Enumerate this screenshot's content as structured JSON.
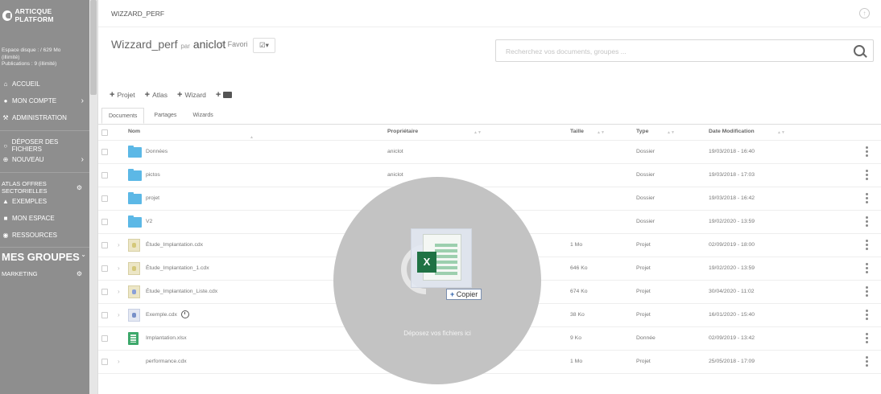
{
  "sidebar": {
    "brand": "ARTICQUE PLATFORM",
    "disk_line1": "Espace disque : / 629 Mo",
    "disk_line2": "(illimité)",
    "disk_line3": "Publications : 9 (illimité)",
    "items": [
      {
        "label": "ACCUEIL",
        "icon": "home-icon"
      },
      {
        "label": "MON COMPTE",
        "icon": "user-icon"
      },
      {
        "label": "ADMINISTRATION",
        "icon": "wrench-icon"
      },
      {
        "label": "DÉPOSER DES FICHIERS",
        "icon": "upload-icon"
      },
      {
        "label": "NOUVEAU",
        "icon": "plus-circle-icon"
      },
      {
        "label": "ATLAS OFFRES SECTORIELLES",
        "icon": "gear-icon"
      },
      {
        "label": "EXEMPLES",
        "icon": "graduation-cap-icon"
      },
      {
        "label": "MON ESPACE",
        "icon": "briefcase-icon"
      },
      {
        "label": "RESSOURCES",
        "icon": "globe-icon"
      }
    ],
    "groups_title": "MES GROUPES",
    "group_item": "MARKETING"
  },
  "topbar": {
    "breadcrumb": "WIZZARD_PERF"
  },
  "header": {
    "title": "Wizzard_perf",
    "par": "par",
    "owner": "aniclot",
    "favori": "Favori",
    "search_placeholder": "Recherchez vos documents, groupes ..."
  },
  "actions": {
    "projet": "Projet",
    "atlas": "Atlas",
    "wizard": "Wizard"
  },
  "tabs": [
    "Documents",
    "Partages",
    "Wizards"
  ],
  "table": {
    "columns": {
      "name": "Nom",
      "owner": "Propriétaire",
      "size": "Taille",
      "type": "Type",
      "date": "Date Modification"
    },
    "rows": [
      {
        "name": "Données",
        "owner": "aniclot",
        "size": "",
        "type": "Dossier",
        "date": "19/03/2018 - 16:40"
      },
      {
        "name": "pictos",
        "owner": "aniclot",
        "size": "",
        "type": "Dossier",
        "date": "19/03/2018 - 17:03"
      },
      {
        "name": "projet",
        "owner": "",
        "size": "",
        "type": "Dossier",
        "date": "19/03/2018 - 16:42"
      },
      {
        "name": "V2",
        "owner": "",
        "size": "",
        "type": "Dossier",
        "date": "19/02/2020 - 13:59"
      },
      {
        "name": "Étude_Implantation.cdx",
        "owner": "",
        "size": "1 Mo",
        "type": "Projet",
        "date": "02/09/2019 - 18:00"
      },
      {
        "name": "Étude_Implantation_1.cdx",
        "owner": "",
        "size": "646 Ko",
        "type": "Projet",
        "date": "19/02/2020 - 13:59"
      },
      {
        "name": "Étude_Implantation_Liste.cdx",
        "owner": "",
        "size": "674 Ko",
        "type": "Projet",
        "date": "30/04/2020 - 11:02"
      },
      {
        "name": "Exemple.cdx",
        "owner": "",
        "size": "38 Ko",
        "type": "Projet",
        "date": "16/01/2020 - 15:40"
      },
      {
        "name": "Implantation.xlsx",
        "owner": "",
        "size": "9 Ko",
        "type": "Donnée",
        "date": "02/09/2019 - 13:42"
      },
      {
        "name": "performance.cdx",
        "owner": "",
        "size": "1 Mo",
        "type": "Projet",
        "date": "25/05/2018 - 17:09"
      }
    ]
  },
  "drop": {
    "text": "Déposez vos fichiers ici",
    "copy_label": "Copier"
  }
}
